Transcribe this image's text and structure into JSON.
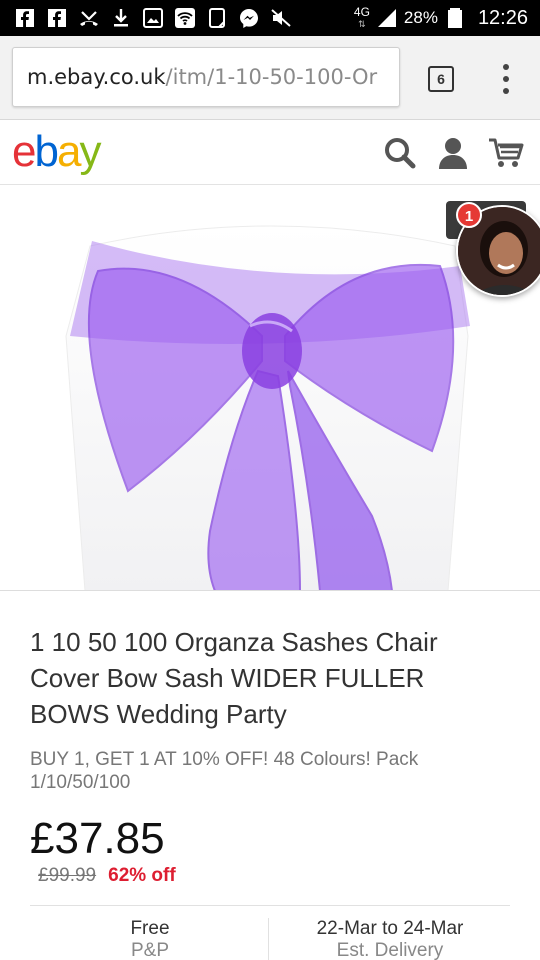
{
  "status_bar": {
    "network_type": "4G",
    "battery_percent": "28%",
    "time": "12:26",
    "icons": [
      "facebook-icon",
      "facebook-icon",
      "missed-call-icon",
      "download-icon",
      "gallery-icon",
      "wifi-icon",
      "screen-icon",
      "messenger-icon",
      "mute-icon",
      "signal-icon",
      "battery-icon"
    ]
  },
  "browser": {
    "url_host": "m.ebay.co.uk",
    "url_path": "/itm/1-10-50-100-Or",
    "tab_count": "6"
  },
  "header": {
    "logo_letters": [
      "e",
      "b",
      "a",
      "y"
    ],
    "icons": [
      "search-icon",
      "user-icon",
      "cart-icon"
    ],
    "colors": {
      "e": "#e53238",
      "b": "#0064d2",
      "a": "#f5af02",
      "y": "#86b817"
    }
  },
  "chat_head": {
    "badge_count": "1"
  },
  "product": {
    "title": "1 10 50 100 Organza Sashes Chair Cover Bow Sash WIDER FULLER BOWS Wedding Party",
    "subtitle": "BUY 1, GET 1 AT 10% OFF! 48 Colours! Pack 1/10/50/100",
    "price": "£37.85",
    "was_price": "£99.99",
    "discount": "62% off",
    "image_description_color": "#8a3fe0"
  },
  "shipping": {
    "postage_main": "Free",
    "postage_sub": "P&P",
    "delivery_main": "22-Mar to 24-Mar",
    "delivery_sub": "Est. Delivery"
  }
}
